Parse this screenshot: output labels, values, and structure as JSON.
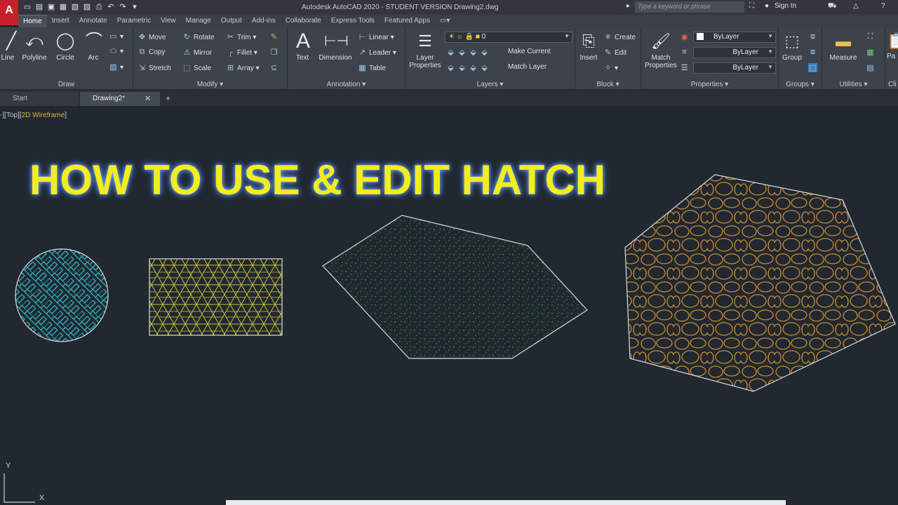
{
  "titlebar": {
    "logo": "A",
    "title": "Autodesk AutoCAD 2020 - STUDENT VERSION   Drawing2.dwg",
    "search_placeholder": "Type a keyword or phrase",
    "sign_in": "Sign In"
  },
  "ribbon_tabs": [
    "Home",
    "Insert",
    "Annotate",
    "Parametric",
    "View",
    "Manage",
    "Output",
    "Add-ins",
    "Collaborate",
    "Express Tools",
    "Featured Apps"
  ],
  "panels": {
    "draw": {
      "title": "Draw",
      "line": "Line",
      "polyline": "Polyline",
      "circle": "Circle",
      "arc": "Arc"
    },
    "modify": {
      "title": "Modify",
      "move": "Move",
      "rotate": "Rotate",
      "trim": "Trim",
      "copy": "Copy",
      "mirror": "Mirror",
      "fillet": "Fillet",
      "stretch": "Stretch",
      "scale": "Scale",
      "array": "Array"
    },
    "annotation": {
      "title": "Annotation",
      "text": "Text",
      "dimension": "Dimension",
      "linear": "Linear",
      "leader": "Leader",
      "table": "Table"
    },
    "layers": {
      "title": "Layers",
      "layer_properties_1": "Layer",
      "layer_properties_2": "Properties",
      "current_layer": "0",
      "make_current": "Make Current",
      "match_layer": "Match Layer"
    },
    "block": {
      "title": "Block",
      "insert": "Insert",
      "create": "Create",
      "edit": "Edit"
    },
    "properties": {
      "title": "Properties",
      "match_1": "Match",
      "match_2": "Properties",
      "color": "ByLayer",
      "lineweight": "ByLayer",
      "linetype": "ByLayer"
    },
    "groups": {
      "title": "Groups",
      "group": "Group"
    },
    "utilities": {
      "title": "Utilities",
      "measure": "Measure"
    },
    "clipboard": {
      "title": "Cli",
      "paste": "Pa"
    }
  },
  "doc_tabs": {
    "start": "Start",
    "drawing": "Drawing2*"
  },
  "viewport": {
    "prefix": "-][Top][",
    "visual_style": "2D Wireframe",
    "suffix": "]"
  },
  "headline": "HOW TO USE & EDIT HATCH",
  "ucs": {
    "y": "Y",
    "x": "X"
  },
  "colors": {
    "background": "#212830",
    "headline": "#f2ee1e",
    "herringbone_hatch": "#2fb7c6",
    "star_hatch": "#c8c233",
    "dots_hatch": "#2e9a3a",
    "stone_hatch": "#c98a2e",
    "boundary": "#d9dcdf"
  }
}
